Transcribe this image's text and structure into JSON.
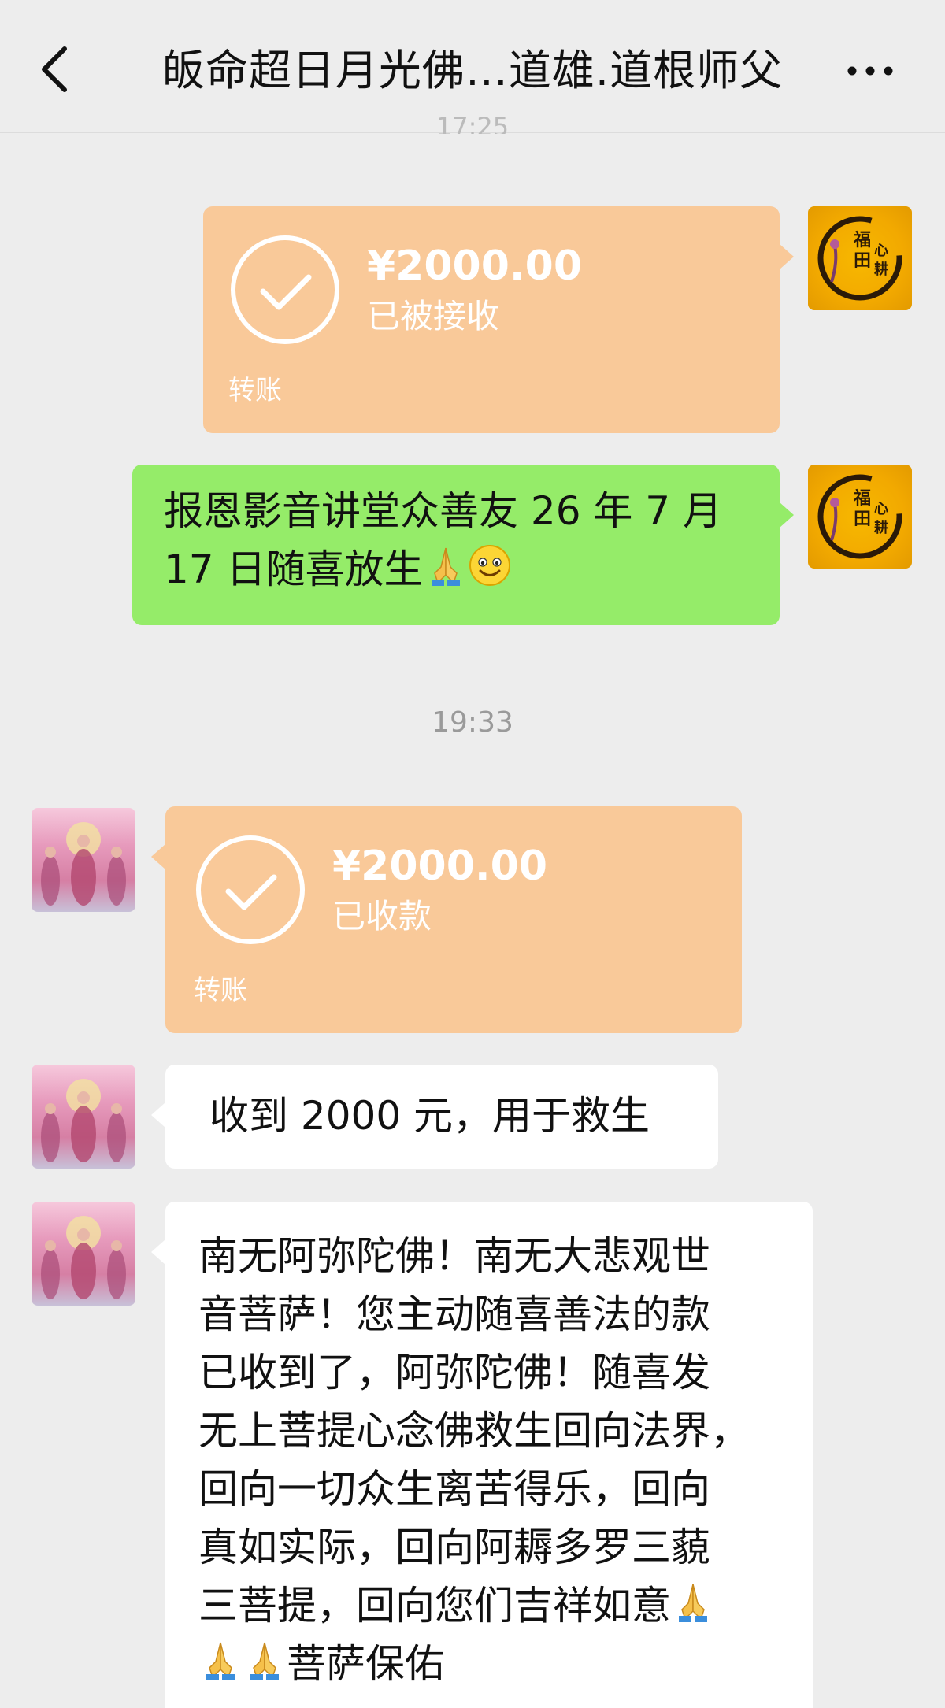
{
  "header": {
    "title": "皈命超日月光佛…道雄.道根师父",
    "back_icon": "chevron-left-icon",
    "more_icon": "more-horizontal-icon"
  },
  "messages": {
    "faded_time": "17:25",
    "m1": {
      "amount": "¥2000.00",
      "status": "已被接收",
      "kind": "转账"
    },
    "m2": {
      "text_line1": "报恩影音讲堂众善友 26 年 7 月",
      "text_line2": "17 日随喜放生"
    },
    "time_label": "19:33",
    "m3": {
      "amount": "¥2000.00",
      "status": "已收款",
      "kind": "转账"
    },
    "m4": {
      "text": "收到 2000 元，用于救生"
    },
    "m5": {
      "lines": [
        "南无阿弥陀佛！南无大悲观世",
        "音菩萨！您主动随喜善法的款",
        "已收到了，阿弥陀佛！随喜发",
        "无上菩提心念佛救生回向法界，",
        "回向一切众生离苦得乐，回向",
        "真如实际，回向阿耨多罗三藐",
        "三菩提，回向您们吉祥如意",
        "菩萨保佑"
      ]
    }
  },
  "colors": {
    "background": "#ededed",
    "transfer_orange": "#f9c999",
    "bubble_green": "#95ec69",
    "bubble_white": "#ffffff"
  },
  "avatars": {
    "me_seal_text": "福田心耕",
    "icons": [
      "pray-hands-icon",
      "smile-emoji-icon"
    ]
  }
}
